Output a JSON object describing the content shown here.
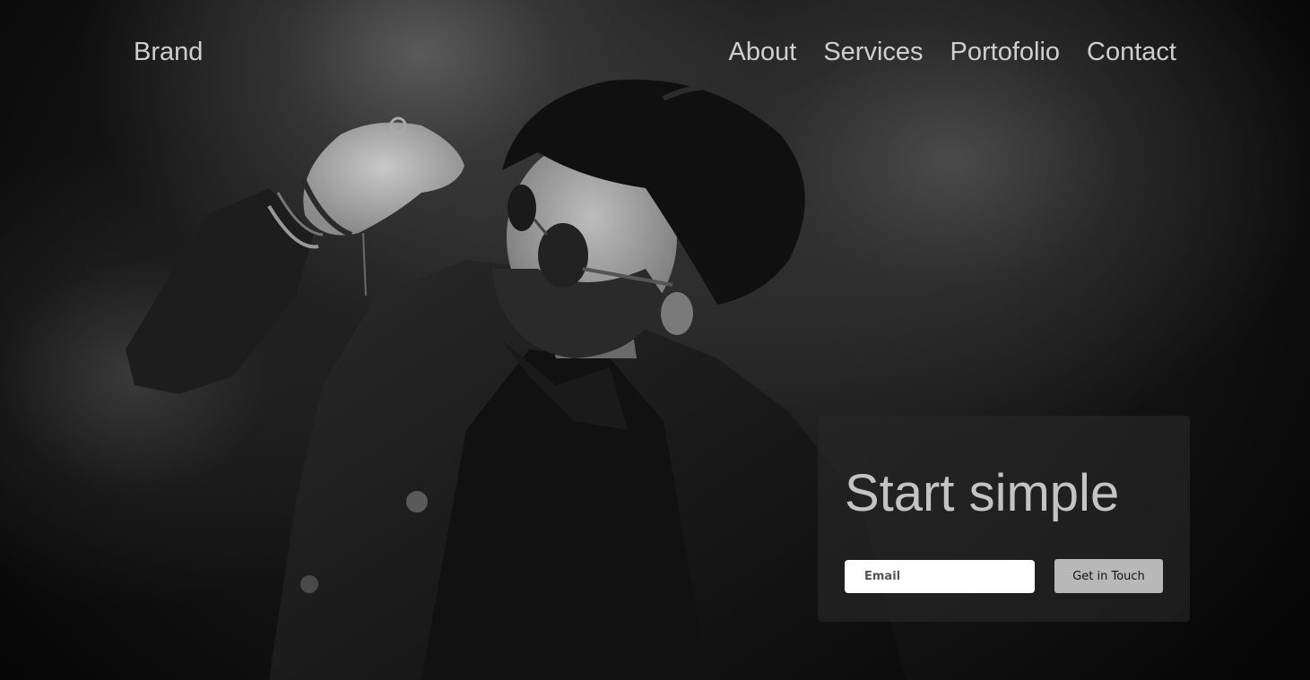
{
  "nav": {
    "brand": "Brand",
    "links": [
      "About",
      "Services",
      "Portofolio",
      "Contact"
    ]
  },
  "hero": {
    "image": "black-and-white-portrait-man-sunglasses",
    "title": "Start simple",
    "email_placeholder": "Email",
    "cta_label": "Get in Touch"
  },
  "colors": {
    "nav_text": "#cfcfcf",
    "title_text": "#c4c4c4",
    "card_bg": "#282828",
    "button_bg": "#b8b8b8"
  }
}
